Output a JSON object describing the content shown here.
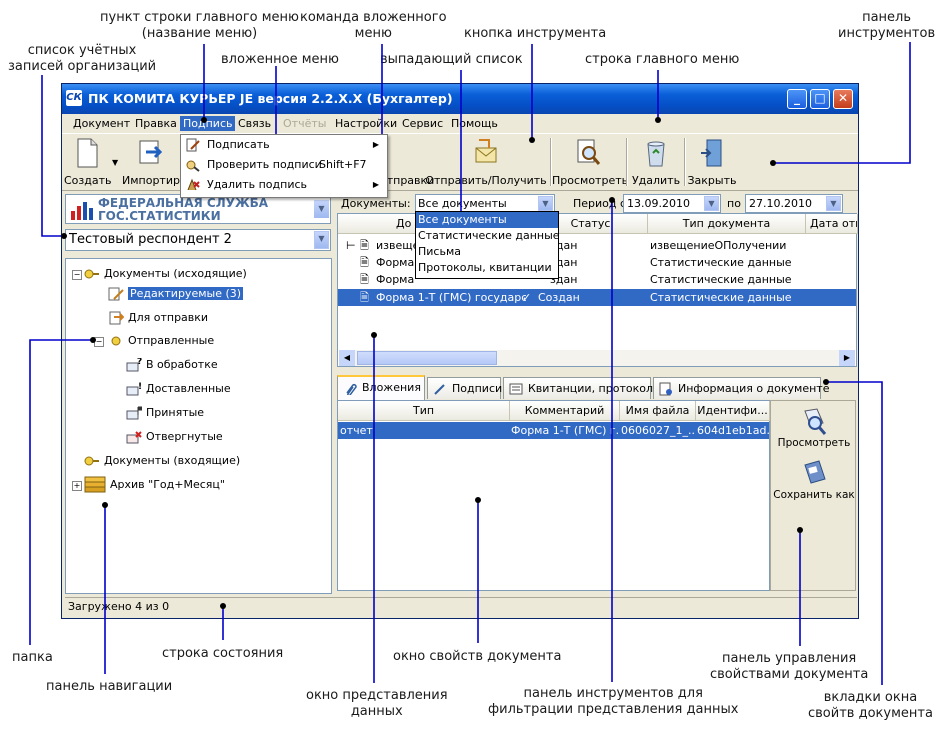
{
  "window": {
    "title": "ПК КОМИТА КУРЬЕР JE версия 2.2.X.X (Бухгалтер)",
    "min": "_",
    "max": "□",
    "close": "✕"
  },
  "menu": {
    "items": [
      "Документ",
      "Правка",
      "Подпись",
      "Связь",
      "Отчёты",
      "Настройки",
      "Сервис",
      "Помощь"
    ]
  },
  "submenu": {
    "items": [
      {
        "label": "Подписать",
        "shortcut": "",
        "arrow": "▶"
      },
      {
        "label": "Проверить подписи",
        "shortcut": "Shift+F7",
        "arrow": ""
      },
      {
        "label": "Удалить подпись",
        "shortcut": "",
        "arrow": "▶"
      }
    ]
  },
  "toolbar": {
    "create": "Создать",
    "import": "Импортиро",
    "send_part": "отправки",
    "send_receive": "Отправить/Получить",
    "view": "Просмотреть",
    "delete": "Удалить",
    "close": "Закрыть"
  },
  "left": {
    "logo_line1": "ФЕДЕРАЛЬНАЯ СЛУЖБА",
    "logo_line2": "ГОС.СТАТИСТИКИ",
    "account": "Тестовый респондент 2",
    "tree": {
      "outgoing": "Документы (исходящие)",
      "editable": "Редактируемые (3)",
      "to_send": "Для отправки",
      "sent": "Отправленные",
      "processing": "В обработке",
      "delivered": "Доставленные",
      "accepted": "Принятые",
      "rejected": "Отвергнутые",
      "incoming": "Документы (входящие)",
      "archive": "Архив \"Год+Месяц\""
    }
  },
  "filter": {
    "docs_label": "Документы:",
    "docs_value": "Все документы",
    "period_label": "Период с",
    "date_from": "13.09.2010",
    "to_label": "по",
    "date_to": "27.10.2010"
  },
  "dropdown": {
    "options": [
      "Все документы",
      "Статистические данные",
      "Письма",
      "Протоколы, квитанции"
    ]
  },
  "grid": {
    "headers": [
      "До",
      "Статус",
      "Тип документа",
      "Дата отп"
    ],
    "rows": [
      {
        "name": "извещен",
        "status": "здан",
        "type": "извещениеОПолучении"
      },
      {
        "name": "Форма 1",
        "status": "здан",
        "type": "Статистические данные"
      },
      {
        "name": "Форма 1",
        "status": "здан",
        "type": "Статистические данные"
      },
      {
        "name": "Форма 1-Т (ГМС) государст",
        "status": "Создан",
        "type": "Статистические данные",
        "check": "✓"
      }
    ]
  },
  "tabs": [
    "Вложения",
    "Подписи",
    "Квитанции, протоколы",
    "Информация о документе"
  ],
  "attachments": {
    "headers": [
      "Тип",
      "Комментарий",
      "Имя файла",
      "Идентифи..."
    ],
    "rows": [
      {
        "type": "отчет",
        "comment": "Форма 1-Т (ГМС) г...",
        "file": "0606027_1_...",
        "id": "604d1eb1ad..."
      }
    ]
  },
  "prop_panel": {
    "view": "Просмотреть",
    "save_as": "Сохранить как"
  },
  "status": {
    "text": "Загружено 4 из 0"
  },
  "annotations": {
    "main_menu_item": "пункт строки главного меню\n(название меню)",
    "nested_command": "команда вложенного\nменю",
    "tool_button": "кнопка инструмента",
    "toolbar_panel": "панель\nинструментов",
    "accounts": "список учётных\nзаписей организаций",
    "submenu": "вложенное меню",
    "dropdown": "выпадающий список",
    "main_menu_row": "строка главного меню",
    "folder": "папка",
    "status_row": "строка состояния",
    "doc_props_window": "окно свойств документа",
    "props_control_panel": "панель управления\nсвойствами документа",
    "nav_panel": "панель навигации",
    "data_view_window": "окно представления\nданных",
    "filter_toolbar": "панель инструментов для\nфильтрации представления данных",
    "props_tabs": "вкладки окна\nсвойтв документа"
  },
  "colors": {
    "accent": "#316ac5",
    "title_bar": "#0a5fd8",
    "annotation_line": "#0000cc"
  }
}
